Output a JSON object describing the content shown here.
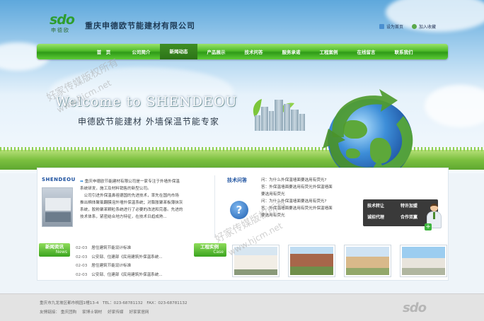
{
  "header": {
    "logo_mark": "sdo",
    "logo_sub": "申德欧",
    "company_name": "重庆申德欧节能建材有限公司",
    "links": {
      "home": "设为首页",
      "favorite": "加入收藏"
    }
  },
  "nav": {
    "items": [
      "首　页",
      "公司简介",
      "新闻动态",
      "产品展示",
      "技术问答",
      "服务承诺",
      "工程案例",
      "在线留言",
      "联系我们"
    ],
    "active_index": 2
  },
  "banner": {
    "welcome": "Welcome to SHENDEOU",
    "slogan": "申德欧节能建材  外墙保温节能专家"
  },
  "about": {
    "tag": "SHENDEOU",
    "lines": [
      "重庆申德欧节能建材有限公司是一家专注于外墙外保温",
      "系统研发，施工及材料销售的新型公司。",
      "　公司引进外保温鼻祖德国的先进技术，率先在国内市场",
      "推出棉体聚氯翻膜泡外墙外保温系统；对膨胀聚苯板薄抹灰",
      "系统，胶粉聚苯颗粒系统进行了必要的改进和完善。先进的",
      "技术体系，紧密结合地方特征，在技术日趋成熟..."
    ]
  },
  "faq": {
    "tag": "技术问答",
    "icon": "?",
    "items": [
      "问：为什么外保温墙面要选用有荧光?",
      "答：外保温墙面要选用有荧光外保温墙面",
      "要选用有荧光",
      "问：为什么外保温墙面要选用有荧光?",
      "答：外保温墙面要选用有荧光外保温墙面",
      "要选用有荧光"
    ]
  },
  "biz_box": {
    "items": [
      "技术转让",
      "特许加盟",
      "诚招代理",
      "合作双赢"
    ]
  },
  "news": {
    "title": "新闻资讯",
    "subtitle": "News",
    "items": [
      {
        "date": "02-03",
        "title": "居住建筑节能设计标准"
      },
      {
        "date": "02-03",
        "title": "公安部、住建部《民用建筑外保温系统..."
      },
      {
        "date": "02-03",
        "title": "居住建筑节能设计标准"
      },
      {
        "date": "02-03",
        "title": "公安部、住建部《民用建筑外保温系统..."
      }
    ]
  },
  "cases": {
    "title": "工程实例",
    "subtitle": "Case"
  },
  "footer": {
    "address": "重庆市九龙坡区都市桃园1幢13-4　TEL：023-68781132　FAX：023-68781132",
    "links_label": "友情链接：",
    "links": [
      "重庆团购",
      "家博士钢材",
      "好家传媒",
      "好家家居网"
    ],
    "logo": "sdo"
  },
  "watermarks": [
    "好家传媒版权所有",
    "www.hjcm.net",
    "好家传媒版权所有",
    "www.hjcm.net"
  ],
  "colors": {
    "nav_green": "#4fbb2a",
    "accent_blue": "#1a4f9e",
    "footer_bg": "#e3e3e3"
  }
}
